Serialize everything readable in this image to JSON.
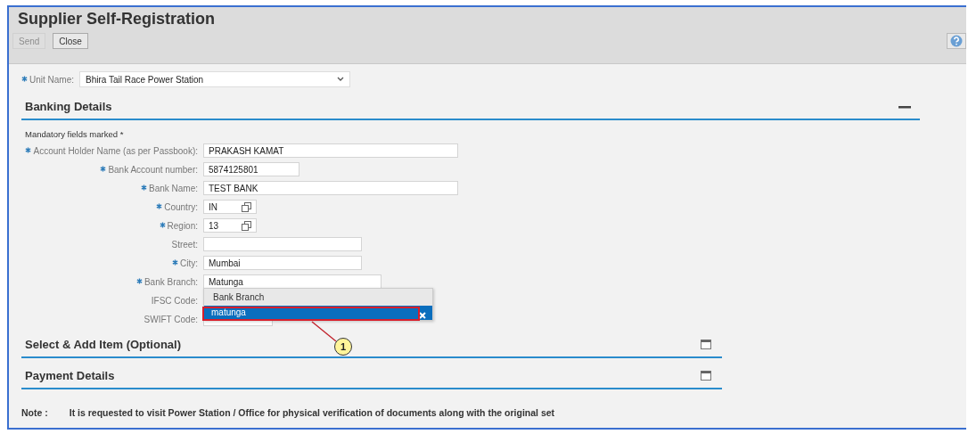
{
  "window": {
    "title": "Supplier Self-Registration"
  },
  "toolbar": [
    {
      "label": "Send",
      "disabled": true
    },
    {
      "label": "Close",
      "disabled": false
    }
  ],
  "unit_field": {
    "label": "Unit Name:",
    "required": true,
    "value": "Bhira Tail Race Power Station"
  },
  "banking_section": {
    "title": "Banking Details",
    "expanded": true,
    "mandatory_note": "Mandatory fields marked *",
    "fields": [
      {
        "label": "Account Holder Name (as per Passbook):",
        "required": true,
        "kind": "wide",
        "value": "PRAKASH KAMAT"
      },
      {
        "label": "Bank Account number:",
        "required": true,
        "kind": "short",
        "value": "5874125801"
      },
      {
        "label": "Bank Name:",
        "required": true,
        "kind": "wide",
        "value": "TEST BANK"
      },
      {
        "label": "Country:",
        "required": true,
        "kind": "lookup",
        "value": "IN"
      },
      {
        "label": "Region:",
        "required": true,
        "kind": "lookup",
        "value": "13"
      },
      {
        "label": "Street:",
        "required": false,
        "kind": "medium"
      },
      {
        "label": "City:",
        "required": true,
        "kind": "medium",
        "value": "Mumbai"
      },
      {
        "label": "Bank Branch:",
        "required": true,
        "kind": "branch",
        "value": "Matunga"
      },
      {
        "label": "IFSC Code:",
        "required": false,
        "kind": "medium"
      },
      {
        "label": "SWIFT Code:",
        "required": false,
        "kind": "small"
      }
    ]
  },
  "suggestion_list": {
    "column": "Bank Branch",
    "options": [
      {
        "text": "matunga",
        "selected": true
      }
    ],
    "callout": "1"
  },
  "other_sections": [
    {
      "title": "Select & Add Item (Optional)",
      "expanded": false
    },
    {
      "title": "Payment Details",
      "expanded": false
    }
  ],
  "note": {
    "label": "Note :",
    "text": "It is requested to visit Power Station / Office for physical verification of documents along with the original set"
  }
}
